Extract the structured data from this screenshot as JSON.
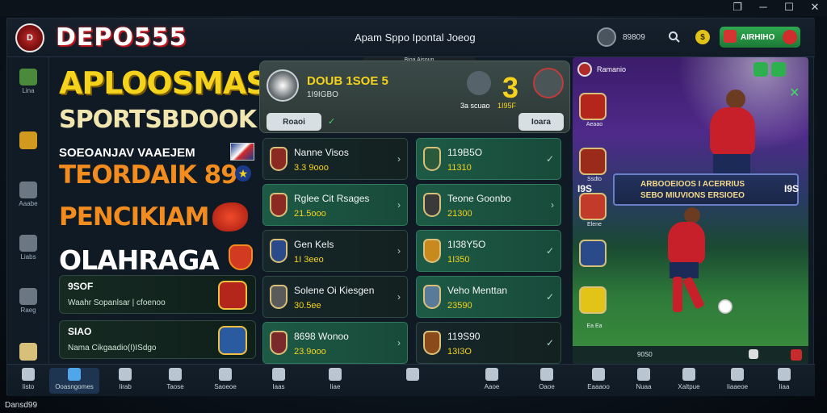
{
  "window": {
    "controls": [
      "❐",
      "─",
      "☐",
      "✕"
    ]
  },
  "header": {
    "brand": "DEPO555",
    "title": "Apam Sppo Ipontal Joeog",
    "user_label": "89809",
    "deposit_label": "AIRHIHO"
  },
  "sidebar": {
    "items": [
      {
        "label": "Lina",
        "icon": "shield-icon"
      },
      {
        "label": "",
        "icon": "badge-icon"
      },
      {
        "label": "Aaabe",
        "icon": "chart-icon"
      },
      {
        "label": "Liabs",
        "icon": "trophy-icon"
      },
      {
        "label": "Raeg",
        "icon": "house-icon"
      },
      {
        "label": "",
        "icon": "crown-icon"
      }
    ]
  },
  "promo": {
    "line1": "APLOOSMAS!",
    "line2": "SPORTSBDOOK",
    "line3": "SOEOANJAV VAAEJEM",
    "line4": "TEORDAIK 89",
    "line5": "PENCIKIAM",
    "line6": "OLAHRAGA",
    "cards": [
      {
        "title": "9SOF",
        "subtitle": "Waahr Sopanlsar | cfoenoo"
      },
      {
        "title": "SIAO",
        "subtitle": "Nama Cikgaadio(I)ISdgo"
      }
    ]
  },
  "featured": {
    "header": "Bioa Aisoun",
    "title": "DOUB 1SOE 5",
    "subtitle": "1I9IGBO",
    "score": "3",
    "left_label": "3a scuao",
    "right_label": "1I95F",
    "btn_left": "Roaoi",
    "btn_right": "Ioara"
  },
  "matches_left": [
    {
      "name": "Nanne Visos",
      "odds": "3.3 9ooo"
    },
    {
      "name": "Rglee Cit Rsages",
      "odds": "21.5ooo"
    },
    {
      "name": "Gen Kels",
      "odds": "1I 3eeo"
    },
    {
      "name": "Solene Oi Kiesgen",
      "odds": "30.5ee"
    },
    {
      "name": "8698 Wonoo",
      "odds": "23.9ooo"
    }
  ],
  "matches_right": [
    {
      "name": "119B5O",
      "odds": "11310"
    },
    {
      "name": "Teone Goonbo",
      "odds": "21300"
    },
    {
      "name": "1I38Y5O",
      "odds": "1I350"
    },
    {
      "name": "Veho Menttan",
      "odds": "23590"
    },
    {
      "name": "119S90",
      "odds": "13I3O"
    }
  ],
  "hero": {
    "header": "Ramanio",
    "banner_left": "I9S",
    "banner_right": "I9S",
    "banner_line1": "ARBOOEIOOS I ACERRIUS",
    "banner_line2": "SEBO MIUVIONS ERSIOEO",
    "side_labels": [
      "Aeaao",
      "Ssdto",
      "Elene",
      "",
      "Ea Ea"
    ],
    "footer": "90S0"
  },
  "bottom_nav": [
    {
      "label": "Iisto",
      "icon": "home-icon"
    },
    {
      "label": "Ooasngomes",
      "icon": "gem-icon",
      "active": true
    },
    {
      "label": "Iirab",
      "icon": "ball-icon"
    },
    {
      "label": "Taose",
      "icon": "flag-icon"
    },
    {
      "label": "Saoeoe",
      "icon": "user-icon"
    },
    {
      "label": "Iaas",
      "icon": "calendar-icon"
    },
    {
      "label": "Iiae",
      "icon": "chevron-icon"
    },
    {
      "label": "",
      "icon": "dots-icon"
    },
    {
      "label": "Aaoe",
      "icon": "pin-icon"
    },
    {
      "label": "Oaoe",
      "icon": "person-icon"
    },
    {
      "label": "Eaaaoo",
      "icon": "clock-icon"
    },
    {
      "label": "Nuaa",
      "icon": "book-icon"
    },
    {
      "label": "Xaltpue",
      "icon": "chart-icon"
    },
    {
      "label": "Iiaaeoe",
      "icon": "coin-icon"
    },
    {
      "label": "Iiaa",
      "icon": "menu-icon"
    }
  ],
  "footer_label": "Dansd99"
}
